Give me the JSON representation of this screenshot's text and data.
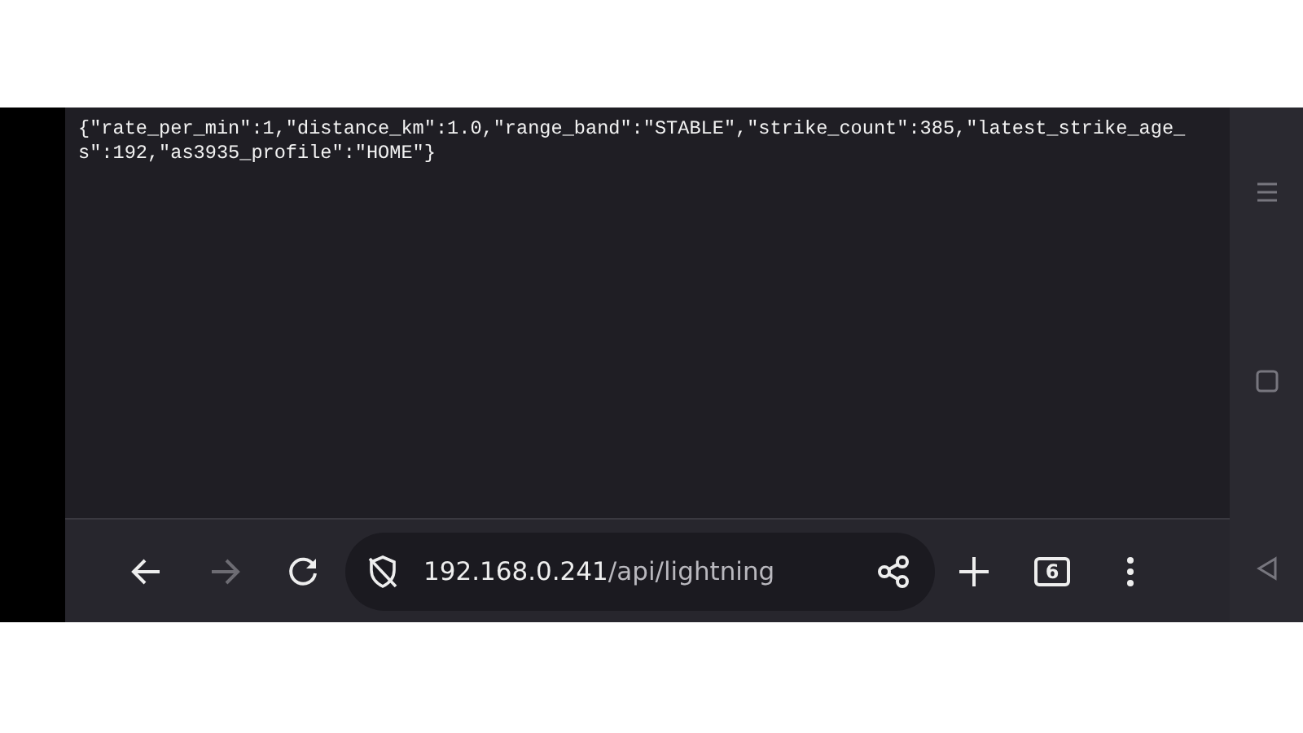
{
  "page": {
    "text_lines": [
      "{\"rate_per_min\":1,\"distance_km\":1.0,\"range_band\":\"STABLE\",\"strike_count\":385,\"latest_strike_age_",
      "s\":192,\"as3935_profile\":\"HOME\"}"
    ]
  },
  "toolbar": {
    "back": {
      "disabled": false
    },
    "forward": {
      "disabled": true
    },
    "url_host": "192.168.0.241",
    "url_path": "/api/lightning",
    "tab_count": "6"
  }
}
